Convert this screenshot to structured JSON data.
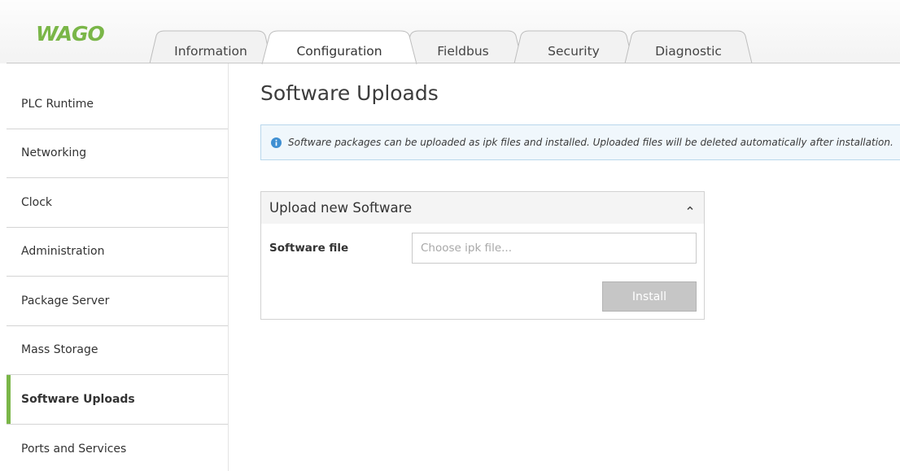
{
  "brand": {
    "logo_text": "WAGO",
    "accent_color": "#7ab648"
  },
  "tabs": [
    {
      "label": "Information",
      "active": false
    },
    {
      "label": "Configuration",
      "active": true
    },
    {
      "label": "Fieldbus",
      "active": false
    },
    {
      "label": "Security",
      "active": false
    },
    {
      "label": "Diagnostic",
      "active": false
    }
  ],
  "sidebar": {
    "items": [
      {
        "label": "PLC Runtime",
        "active": false
      },
      {
        "label": "Networking",
        "active": false
      },
      {
        "label": "Clock",
        "active": false
      },
      {
        "label": "Administration",
        "active": false
      },
      {
        "label": "Package Server",
        "active": false
      },
      {
        "label": "Mass Storage",
        "active": false
      },
      {
        "label": "Software Uploads",
        "active": true
      },
      {
        "label": "Ports and Services",
        "active": false
      }
    ]
  },
  "main": {
    "title": "Software Uploads",
    "info": {
      "icon": "info-icon",
      "text": "Software packages can be uploaded as ipk files and installed. Uploaded files will be deleted automatically after installation."
    },
    "upload_panel": {
      "title": "Upload new Software",
      "collapse_icon": "chevron-up-icon",
      "field_label": "Software file",
      "file_input": {
        "value": "",
        "placeholder": "Choose ipk file..."
      },
      "install_label": "Install"
    }
  }
}
